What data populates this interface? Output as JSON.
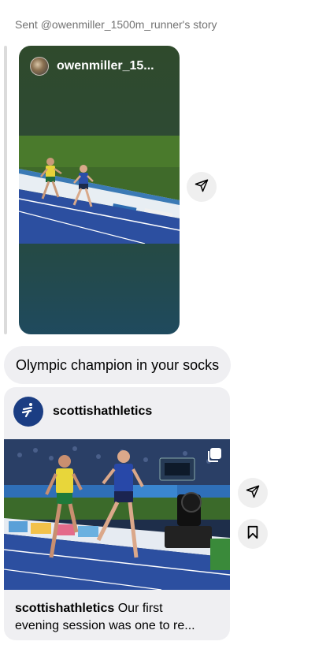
{
  "story_share": {
    "caption": "Sent @owenmiller_1500m_runner's story",
    "username": "owenmiller_15..."
  },
  "message": {
    "text": "Olympic champion in your socks"
  },
  "post_share": {
    "username": "scottishathletics",
    "caption_user": "scottishathletics",
    "caption_line1": "Our first",
    "caption_line2": "evening session was one to re..."
  },
  "icons": {
    "share": "paper-plane-icon",
    "save": "bookmark-icon",
    "carousel": "multiple-photos-icon"
  },
  "colors": {
    "bubble_bg": "#efeff2",
    "brand_blue": "#1b3d83",
    "track_blue": "#2c4fa0"
  }
}
